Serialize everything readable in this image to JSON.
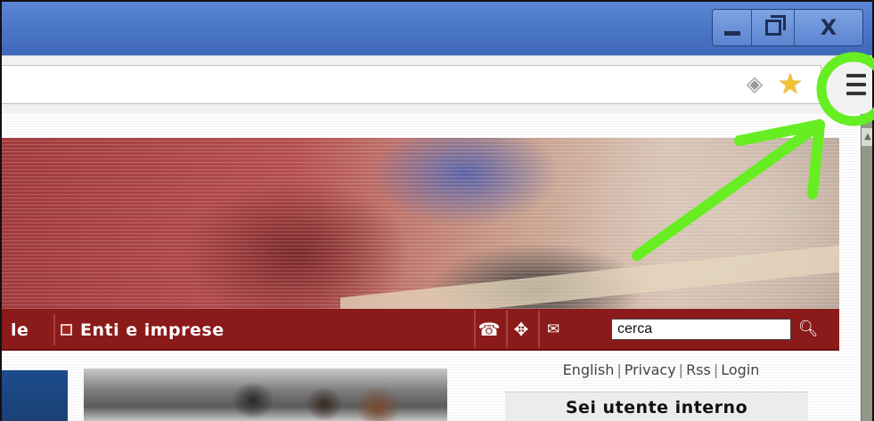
{
  "window": {
    "minimize_icon": "minimize-icon",
    "maximize_icon": "restore-icon",
    "close_label": "X"
  },
  "toolbar": {
    "page_action_icon": "page-action-icon",
    "bookmark_icon": "star-icon",
    "menu_icon": "hamburger-menu-icon"
  },
  "nav": {
    "item_partial": "le",
    "item_enti": "Enti e imprese",
    "search_value": "cerca",
    "icons": [
      "phone-icon",
      "map-icon",
      "mail-icon",
      "search-icon"
    ]
  },
  "side": {
    "links": [
      "English",
      "Privacy",
      "Rss",
      "Login"
    ],
    "separator": "|",
    "internal_box_title": "Sei utente interno"
  },
  "colors": {
    "nav_bg": "#8b1a1a",
    "titlebar": "#4a74c6",
    "highlight": "#66ee22"
  }
}
